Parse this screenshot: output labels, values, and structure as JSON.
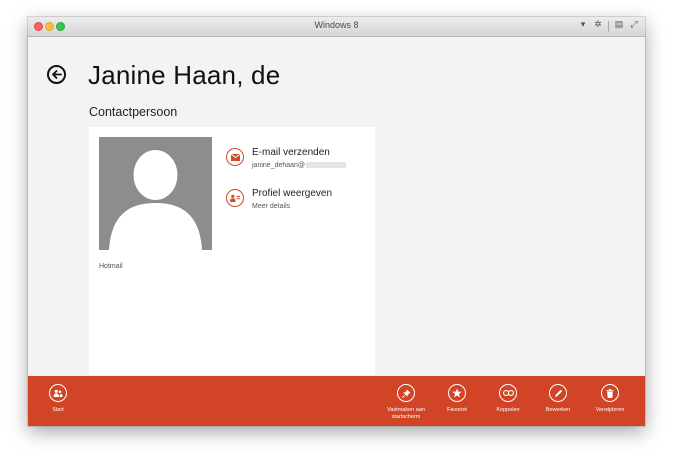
{
  "window": {
    "title": "Windows 8"
  },
  "header": {
    "name": "Janine Haan, de",
    "type": "Contactpersoon"
  },
  "card": {
    "source": "Hotmail",
    "actions": [
      {
        "title": "E-mail verzenden",
        "subtitle": "janine_dehaan@",
        "icon": "envelope-icon"
      },
      {
        "title": "Profiel weergeven",
        "subtitle": "Meer details",
        "icon": "profile-card-icon"
      }
    ]
  },
  "appbar": {
    "start": {
      "label": "Start",
      "icon": "people-icon"
    },
    "pin": {
      "label": "Vastmaken aan startscherm",
      "icon": "pin-icon"
    },
    "favorite": {
      "label": "Favoriet",
      "icon": "star-icon"
    },
    "link": {
      "label": "Koppelen",
      "icon": "link-icon"
    },
    "edit": {
      "label": "Bewerken",
      "icon": "pencil-icon"
    },
    "delete": {
      "label": "Verwijderen",
      "icon": "trash-icon"
    }
  },
  "colors": {
    "accent": "#d14425",
    "avatar_bg": "#8d8d8d",
    "page_bg": "#f3f3f3"
  }
}
